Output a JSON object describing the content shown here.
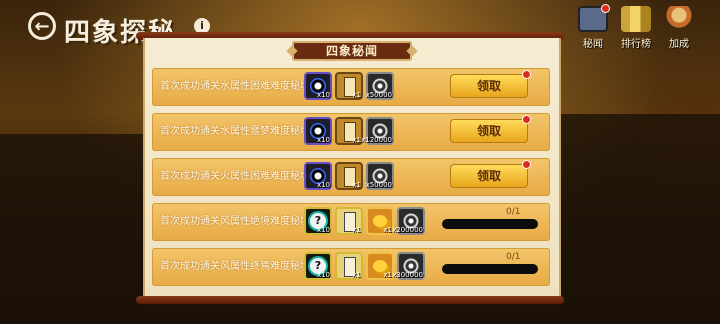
{
  "header": {
    "title": "四象探秘",
    "info": "i",
    "buttons": [
      {
        "label": "秘闻",
        "icon": "tv-screen-icon",
        "color": "#5b6a8a"
      },
      {
        "label": "排行榜",
        "icon": "trophy-bars-icon",
        "color": "#c9a53a"
      },
      {
        "label": "加成",
        "icon": "character-boost-icon",
        "color": "#c86a2a"
      }
    ]
  },
  "panel": {
    "title": "四象秘闻"
  },
  "rows": [
    {
      "text": "首次成功通关水属性困难难度秘境",
      "items": [
        {
          "type": "orb",
          "count": "x10"
        },
        {
          "type": "scroll",
          "count": "x1"
        },
        {
          "type": "money",
          "count": "x50000"
        }
      ],
      "button": "领取",
      "progress": null
    },
    {
      "text": "首次成功通关水属性噩梦难度秘境",
      "items": [
        {
          "type": "orb",
          "count": "x10"
        },
        {
          "type": "scroll",
          "count": "x1"
        },
        {
          "type": "money",
          "count": "x120000"
        }
      ],
      "button": "领取",
      "progress": null
    },
    {
      "text": "首次成功通关火属性困难难度秘境",
      "items": [
        {
          "type": "orb",
          "count": "x10"
        },
        {
          "type": "scroll",
          "count": "x1"
        },
        {
          "type": "money",
          "count": "x50000"
        }
      ],
      "button": "领取",
      "progress": null
    },
    {
      "text": "首次成功通关风属性绝境难度秘境",
      "items": [
        {
          "type": "orb-q",
          "count": "x10"
        },
        {
          "type": "scroll2",
          "count": "x1"
        },
        {
          "type": "coin",
          "count": "x1"
        },
        {
          "type": "money",
          "count": "x200000"
        }
      ],
      "button": null,
      "progress": "0/1"
    },
    {
      "text": "首次成功通关风属性终焉难度秘境",
      "items": [
        {
          "type": "orb-q",
          "count": "x10"
        },
        {
          "type": "scroll2",
          "count": "x1"
        },
        {
          "type": "coin",
          "count": "x1"
        },
        {
          "type": "money",
          "count": "x300000"
        }
      ],
      "button": null,
      "progress": "0/1"
    }
  ],
  "colors": {
    "row": "#efb654",
    "claim": "#f6c23a",
    "title_bg": "#6a2c10"
  }
}
